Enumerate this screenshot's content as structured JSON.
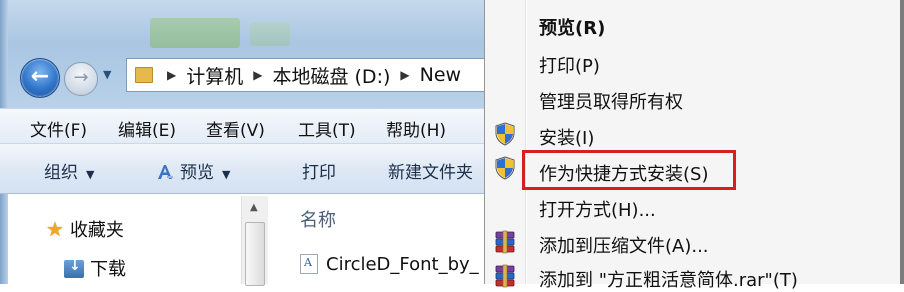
{
  "window": {
    "address": {
      "segments": [
        "计算机",
        "本地磁盘 (D:)",
        "New"
      ]
    },
    "menubar": [
      "文件(F)",
      "编辑(E)",
      "查看(V)",
      "工具(T)",
      "帮助(H)"
    ],
    "commandbar": {
      "organize": "组织",
      "preview": "预览",
      "print": "打印",
      "new_folder": "新建文件夹"
    },
    "navpane": {
      "favorites": "收藏夹",
      "downloads": "下载"
    },
    "filelist": {
      "column_name": "名称",
      "file": "CircleD_Font_by_"
    }
  },
  "context_menu": {
    "items": [
      {
        "label": "预览(R)",
        "bold": true,
        "icon": ""
      },
      {
        "label": "打印(P)",
        "icon": ""
      },
      {
        "label": "管理员取得所有权",
        "icon": ""
      },
      {
        "label": "安装(I)",
        "icon": "uac-shield-icon"
      },
      {
        "label": "作为快捷方式安装(S)",
        "icon": "uac-shield-icon",
        "highlighted": true
      },
      {
        "label": "打开方式(H)...",
        "icon": ""
      },
      {
        "label": "添加到压缩文件(A)...",
        "icon": "winrar-icon"
      },
      {
        "label": "添加到 \"方正粗活意简体.rar\"(T)",
        "icon": "winrar-icon"
      }
    ]
  },
  "colors": {
    "highlight_border": "#d6201f",
    "menu_bg": "#f5f5f5"
  }
}
